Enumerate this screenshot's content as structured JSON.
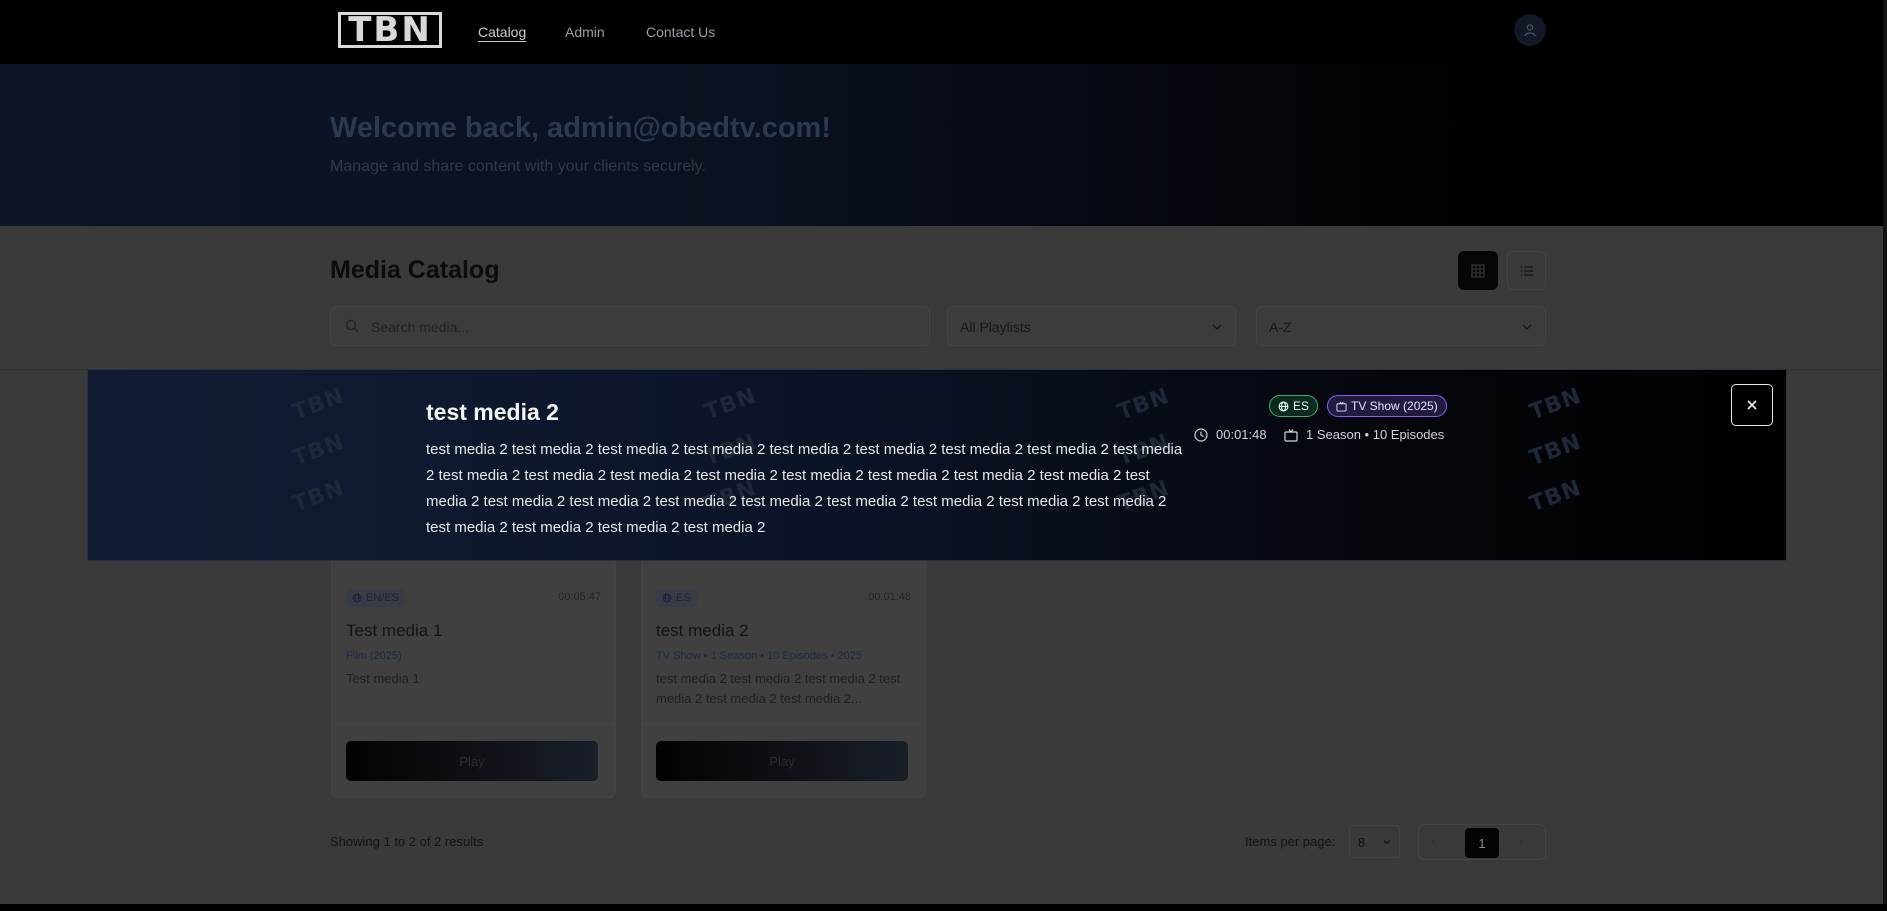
{
  "header": {
    "logo": "TBN",
    "nav": [
      "Catalog",
      "Admin",
      "Contact Us"
    ]
  },
  "hero": {
    "title": "Welcome back, admin@obedtv.com!",
    "subtitle": "Manage and share content with your clients securely."
  },
  "catalog": {
    "title": "Media Catalog",
    "search_placeholder": "Search media...",
    "playlist_filter": "All Playlists",
    "sort": "A-Z"
  },
  "cards": [
    {
      "language": "EN/ES",
      "duration": "00:05:47",
      "title": "Test media 1",
      "meta": "Film (2025)",
      "description": "Test media 1",
      "play_label": "Play"
    },
    {
      "language": "ES",
      "duration": "00:01:48",
      "title": "test media 2",
      "meta": "TV Show • 1 Season • 10 Episodes • 2025",
      "description": "test media 2 test media 2 test media 2 test media 2 test media 2 test media 2...",
      "play_label": "Play"
    }
  ],
  "pagination": {
    "results_text": "Showing 1 to 2 of 2 results",
    "items_per_page_label": "Items per page:",
    "items_per_page": "8",
    "current_page": "1",
    "prev": "‹",
    "next": "›"
  },
  "banner": {
    "watermark": "TBN",
    "title": "test media 2",
    "description": "test media 2 test media 2 test media 2 test media 2 test media 2 test media 2 test media 2 test media 2 test media 2 test media 2 test media 2 test media 2 test media 2 test media 2 test media 2 test media 2 test media 2 test media 2 test media 2 test media 2 test media 2 test media 2 test media 2 test media 2 test media 2 test media 2 test media 2 test media 2 test media 2 test media 2",
    "language": "ES",
    "type_label": "TV Show (2025)",
    "duration": "00:01:48",
    "seasons": "1 Season • 10 Episodes",
    "close": "×"
  },
  "colors": {
    "accent_green": "#2bb673",
    "accent_purple": "#8b5cf6",
    "card1_strip": "#5a1515",
    "card2_strip": "#2a2020"
  }
}
